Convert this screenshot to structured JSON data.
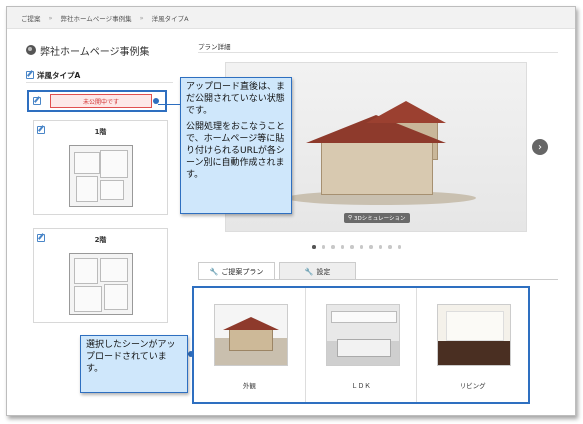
{
  "breadcrumb": [
    "ご提案",
    "弊社ホームページ事例集",
    "洋風タイプA"
  ],
  "breadcrumb_sep": "»",
  "sidebar": {
    "site_title": "弊社ホームページ事例集",
    "plan_name": "洋風タイプA",
    "status_badge": "未公開中です",
    "floors": [
      {
        "label": "1階"
      },
      {
        "label": "2階"
      }
    ]
  },
  "main": {
    "section_label": "プラン詳細",
    "image_caption": "3Dシミュレーション",
    "next_arrow": "›",
    "slide_count": 10,
    "active_slide": 0,
    "tabs": [
      {
        "label": "ご提案プラン",
        "icon": "wrench-icon",
        "active": true
      },
      {
        "label": "設定",
        "icon": "wrench-icon",
        "active": false
      }
    ],
    "scenes": [
      {
        "label": "外観"
      },
      {
        "label": "ＬＤＫ"
      },
      {
        "label": "リビング"
      }
    ]
  },
  "callouts": {
    "status_note_1": "アップロード直後は、まだ公開されていない状態です。",
    "status_note_2": "公開処理をおこなうことで、ホームページ等に貼り付けられるURLが各シーン別に自動作成されます。",
    "scenes_note": "選択したシーンがアップロードされています。"
  },
  "colors": {
    "accent": "#2e6fc0",
    "callout_bg": "#cfe7fb",
    "status_red": "#d03030"
  }
}
